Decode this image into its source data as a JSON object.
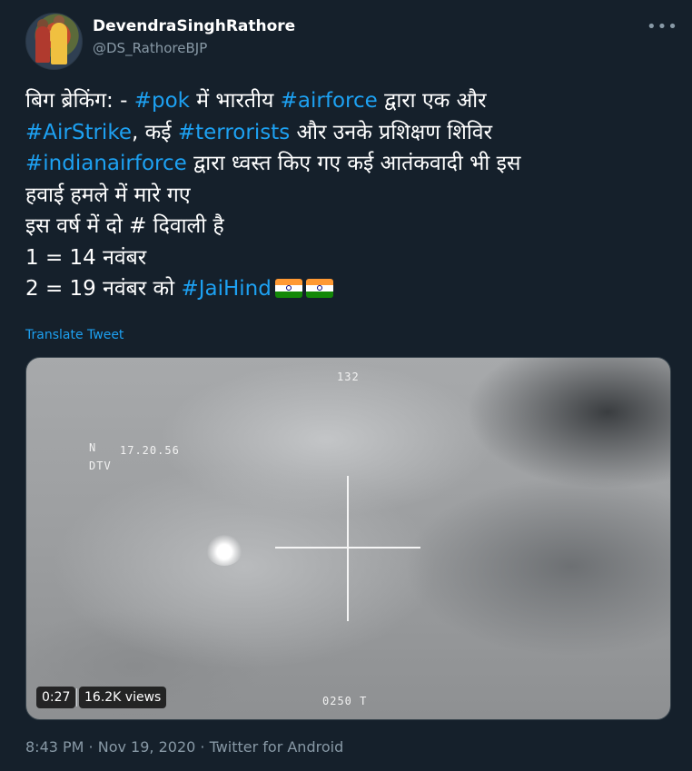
{
  "author": {
    "display_name": "DevendraSinghRathore",
    "handle": "@DS_RathoreBJP"
  },
  "more_icon": "more-horizontal-icon",
  "tweet": {
    "lines": [
      [
        {
          "text": "बिग ब्रेकिंग: - ",
          "type": "text"
        },
        {
          "text": "#pok",
          "type": "hashtag"
        },
        {
          "text": " में भारतीय  ",
          "type": "text"
        },
        {
          "text": "#airforce",
          "type": "hashtag"
        },
        {
          "text": " द्वारा एक और",
          "type": "text"
        }
      ],
      [
        {
          "text": "#AirStrike",
          "type": "hashtag"
        },
        {
          "text": ", कई ",
          "type": "text"
        },
        {
          "text": "#terrorists",
          "type": "hashtag"
        },
        {
          "text": " और उनके प्रशिक्षण शिविर",
          "type": "text"
        }
      ],
      [
        {
          "text": "#indianairforce",
          "type": "hashtag"
        },
        {
          "text": " द्वारा ध्वस्त किए गए कई आतंकवादी भी इस",
          "type": "text"
        }
      ],
      [
        {
          "text": "हवाई हमले में मारे गए",
          "type": "text"
        }
      ],
      [
        {
          "text": " इस वर्ष में दो # दिवाली है",
          "type": "text"
        }
      ],
      [
        {
          "text": " 1 = 14 नवंबर",
          "type": "text"
        }
      ],
      [
        {
          "text": " 2 = 19 नवंबर को ",
          "type": "text"
        },
        {
          "text": "#JaiHind",
          "type": "hashtag"
        },
        {
          "text": "",
          "type": "flag"
        },
        {
          "text": "",
          "type": "flag"
        }
      ]
    ],
    "translate_label": "Translate Tweet"
  },
  "media": {
    "hud_top": "132",
    "hud_north": "N",
    "hud_time": "17.20.56",
    "hud_mode": "DTV",
    "hud_bottom": "0250  T",
    "duration": "0:27",
    "views": "16.2K views"
  },
  "meta": {
    "time": "8:43 PM",
    "sep1": " · ",
    "date": "Nov 19, 2020",
    "sep2": " · ",
    "source": "Twitter for Android"
  },
  "colors": {
    "background": "#15202b",
    "hashtag": "#1da1f2",
    "secondary_text": "#8899a6"
  }
}
